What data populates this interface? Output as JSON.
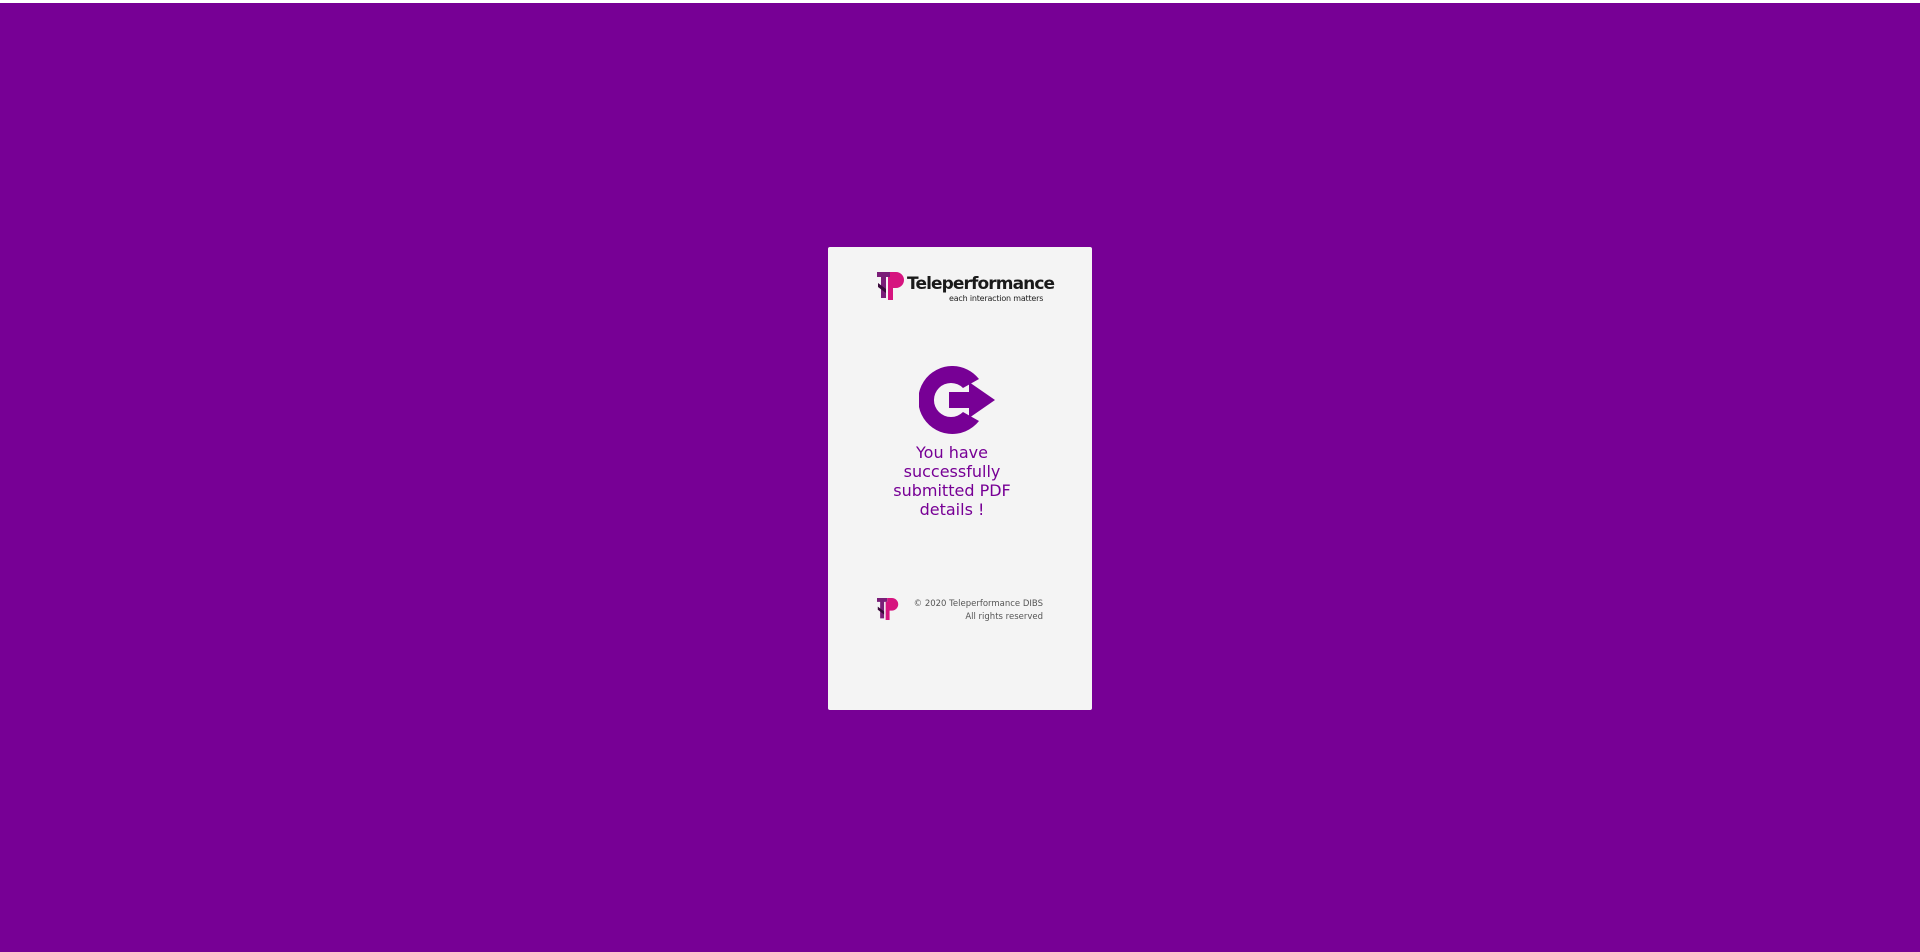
{
  "colors": {
    "background": "#770095",
    "card": "#f4f4f4",
    "accent": "#770095",
    "brand_pink": "#d6147f"
  },
  "brand": {
    "name": "Teleperformance",
    "tagline": "each interaction matters",
    "logo_icon": "tp-logo-icon"
  },
  "status": {
    "icon": "logout-arrow-icon",
    "message": "You have successfully submitted PDF details !"
  },
  "footer": {
    "logo_icon": "tp-logo-icon",
    "copyright": "© 2020 Teleperformance DIBS",
    "rights": "All rights reserved"
  }
}
